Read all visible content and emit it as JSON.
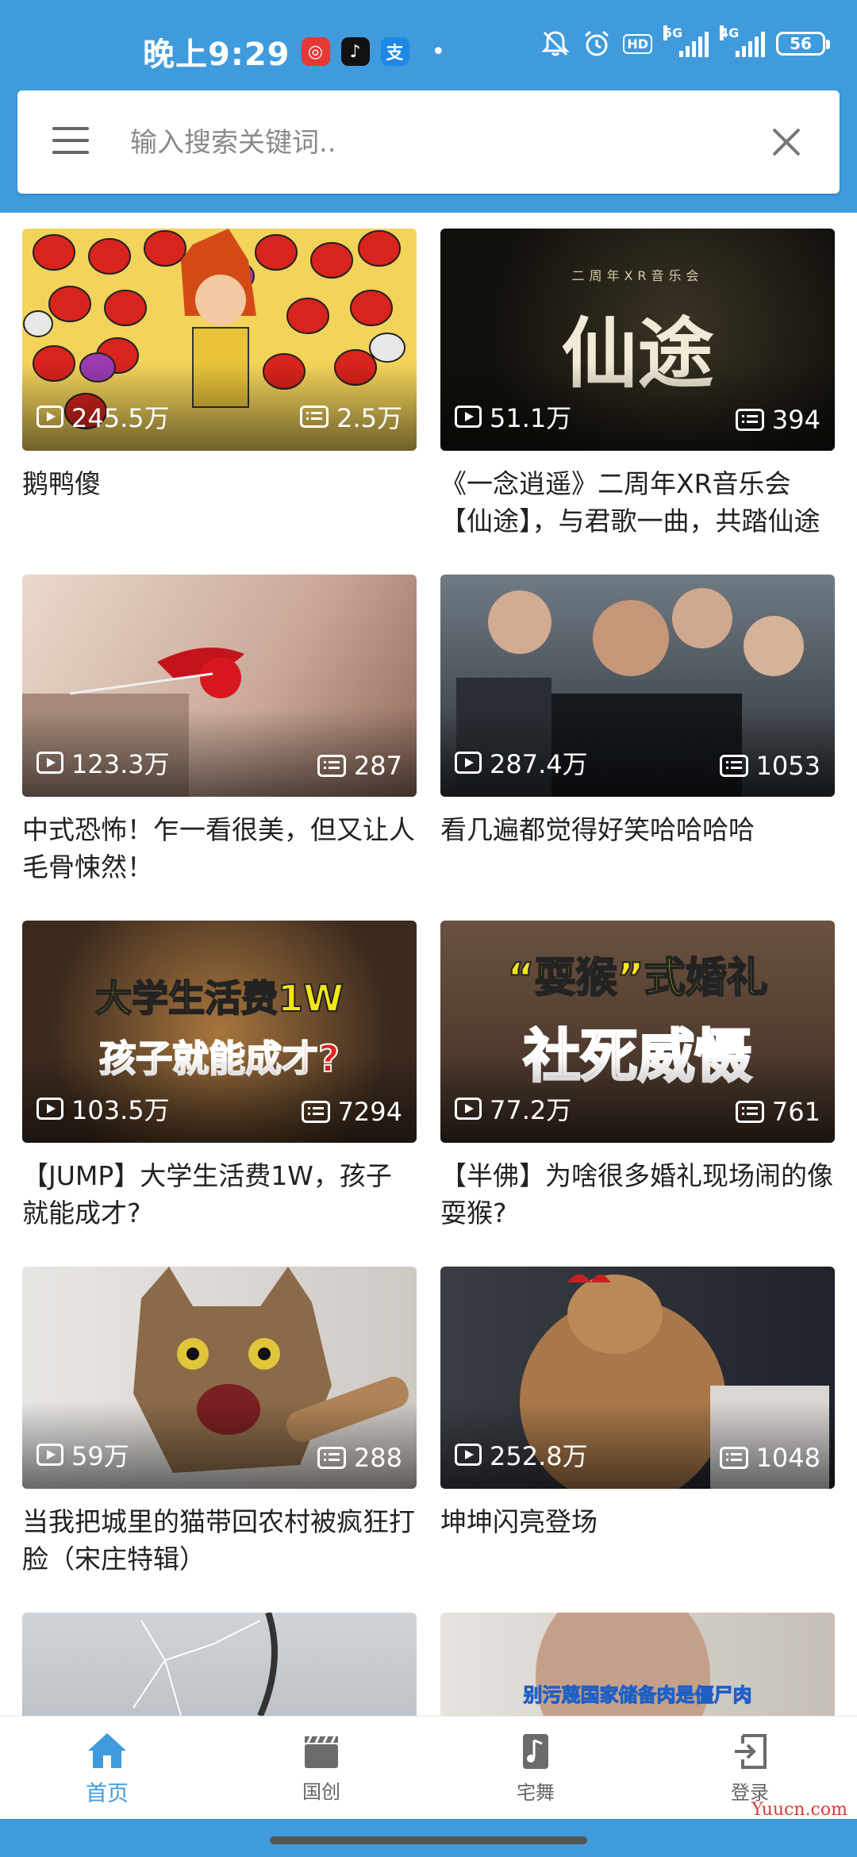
{
  "status_bar": {
    "time": "晚上9:29",
    "network_5g": "5G",
    "network_4g": "4G",
    "hd_label": "HD",
    "battery": "56",
    "app_icons": [
      "netease-music-icon",
      "tiktok-icon",
      "alipay-icon"
    ]
  },
  "search": {
    "placeholder": "输入搜索关键词..",
    "value": ""
  },
  "videos": [
    {
      "title": "鹅鸭傻",
      "plays": "245.5万",
      "danmaku": "2.5万"
    },
    {
      "title": "《一念逍遥》二周年XR音乐会【仙途】，与君歌一曲，共踏仙途",
      "plays": "51.1万",
      "danmaku": "394",
      "overlay_small": "二周年XR音乐会",
      "overlay_big": "仙途"
    },
    {
      "title": "中式恐怖！乍一看很美，但又让人毛骨悚然！",
      "plays": "123.3万",
      "danmaku": "287"
    },
    {
      "title": "看几遍都觉得好笑哈哈哈哈",
      "plays": "287.4万",
      "danmaku": "1053"
    },
    {
      "title": "【JUMP】大学生活费1W，孩子就能成才?",
      "plays": "103.5万",
      "danmaku": "7294",
      "overlay_line1": "大学生活费1W",
      "overlay_line2": "孩子就能成才?"
    },
    {
      "title": "【半佛】为啥很多婚礼现场闹的像耍猴?",
      "plays": "77.2万",
      "danmaku": "761",
      "overlay_line1": "“耍猴”式婚礼",
      "overlay_line2": "社死威慑"
    },
    {
      "title": "当我把城里的猫带回农村被疯狂打脸（宋庄特辑）",
      "plays": "59万",
      "danmaku": "288"
    },
    {
      "title": "坤坤闪亮登场",
      "plays": "252.8万",
      "danmaku": "1048"
    },
    {
      "title": "",
      "plays": "",
      "danmaku": ""
    },
    {
      "title": "",
      "plays": "",
      "danmaku": "",
      "overlay_line1": "别污蔑国家储备肉是僵尸肉"
    }
  ],
  "nav": {
    "home": "首页",
    "guochuang": "国创",
    "dance": "宅舞",
    "login": "登录"
  },
  "watermark": "Yuucn.com",
  "colors": {
    "accent": "#3f9bdc",
    "text": "#222222",
    "nav_inactive": "#666666"
  }
}
